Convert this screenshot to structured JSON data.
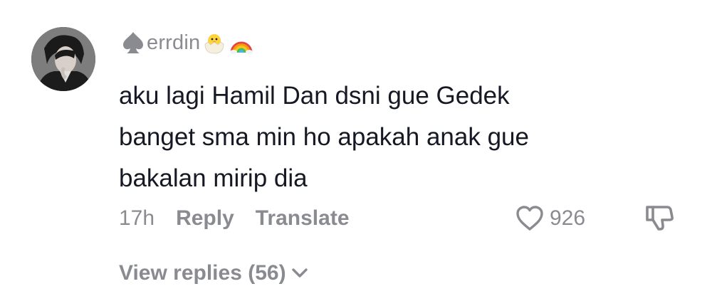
{
  "comment": {
    "username": "errdin",
    "username_prefix_icon": "spade-icon",
    "username_suffix_icons": [
      "hatching-chick-emoji",
      "rainbow-emoji"
    ],
    "avatar_icon": "user-avatar",
    "text_lines": [
      "aku lagi Hamil Dan dsni gue Gedek",
      "banget sma min ho apakah anak gue",
      "bakalan mirip dia"
    ],
    "timestamp": "17h",
    "reply_label": "Reply",
    "translate_label": "Translate",
    "like_icon": "heart-outline-icon",
    "like_count": "926",
    "dislike_icon": "thumbs-down-icon",
    "view_replies_label": "View replies (56)",
    "view_replies_icon": "chevron-down-icon"
  },
  "colors": {
    "text_primary": "#161823",
    "text_secondary": "#8a8b91",
    "background": "#ffffff"
  }
}
